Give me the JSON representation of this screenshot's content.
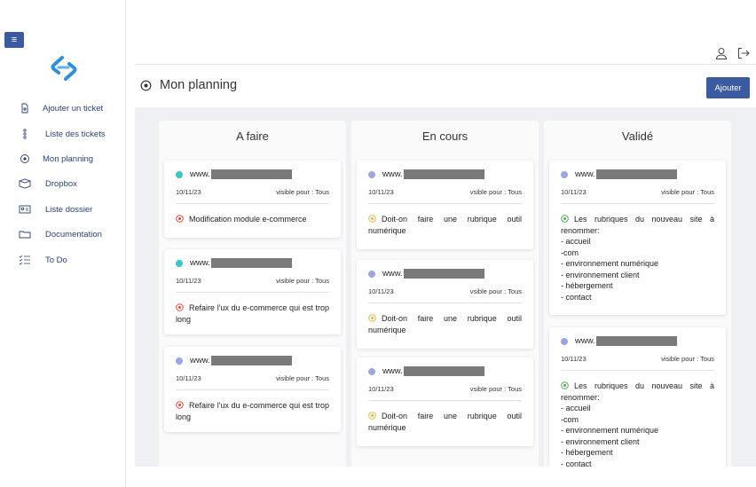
{
  "menu_toggle": "≡",
  "sidebar": {
    "items": [
      {
        "label": "Ajouter un ticket",
        "icon": "file-plus-icon"
      },
      {
        "label": "Liste des tickets",
        "icon": "dots-vertical-icon"
      },
      {
        "label": "Mon planning",
        "icon": "target-icon"
      },
      {
        "label": "Dropbox",
        "icon": "box-icon"
      },
      {
        "label": "Liste dossier",
        "icon": "id-card-icon"
      },
      {
        "label": "Documentation",
        "icon": "folder-icon"
      },
      {
        "label": "To Do",
        "icon": "checklist-icon"
      }
    ]
  },
  "header": {
    "title": "Mon planning",
    "add_label": "Ajouter"
  },
  "colors": {
    "primary": "#3b5aa0",
    "dot_teal": "#3cc6c6",
    "dot_lavender": "#9aa6e3",
    "status_red": "#e04a3a",
    "status_yellow": "#e8b43a",
    "status_green": "#4caf50"
  },
  "columns": [
    {
      "title": "A faire",
      "cards": [
        {
          "url": "www.",
          "date": "10/11/23",
          "visibility": "visible pour : Tous",
          "text": "Modification module e-commerce",
          "lines": []
        },
        {
          "url": "www.",
          "date": "10/11/23",
          "visibility": "visible pour : Tous",
          "text": "Refaire l'ux du e-commerce qui est trop long",
          "lines": []
        },
        {
          "url": "www.",
          "date": "10/11/23",
          "visibility": "visible pour : Tous",
          "text": "Refaire l'ux du e-commerce qui est trop long",
          "lines": []
        }
      ]
    },
    {
      "title": "En cours",
      "cards": [
        {
          "url": "www.",
          "date": "10/11/23",
          "visibility": "vsible pour : Tous",
          "text": "Doit-on faire une rubrique outil numérique",
          "lines": []
        },
        {
          "url": "www.",
          "date": "10/11/23",
          "visibility": "vsible pour : Tous",
          "text": "Doit-on faire une rubrique outil numérique",
          "lines": []
        },
        {
          "url": "www.",
          "date": "10/11/23",
          "visibility": "vsible pour : Tous",
          "text": "Doit-on faire une rubrique outil numérique",
          "lines": []
        }
      ]
    },
    {
      "title": "Validé",
      "cards": [
        {
          "url": "www.",
          "date": "10/11/23",
          "visibility": "visible pour : Tous",
          "text": "Les rubriques du nouveau site à renommer:",
          "lines": [
            "- accueil",
            "-com",
            "- environnement numérique",
            "- environnement client",
            "- hébergement",
            "- contact"
          ]
        },
        {
          "url": "www.",
          "date": "10/11/23",
          "visibility": "visible pour : Tous",
          "text": "Les rubriques du nouveau site à renommer:",
          "lines": [
            "- accueil",
            "-com",
            "- environnement numérique",
            "- environnement client",
            "- hébergement",
            "- contact"
          ]
        }
      ]
    }
  ]
}
